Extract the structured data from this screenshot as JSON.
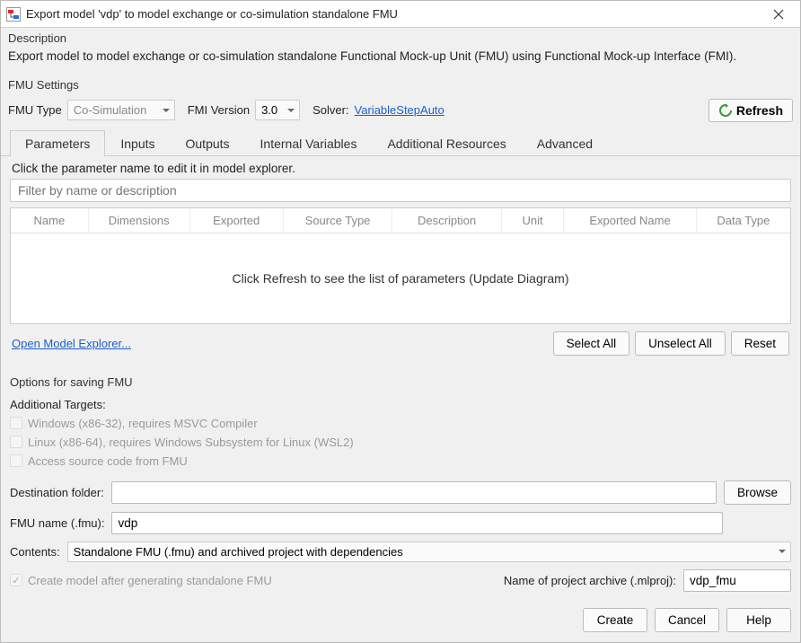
{
  "window": {
    "title": "Export model 'vdp' to model exchange or co-simulation standalone FMU"
  },
  "description": {
    "heading": "Description",
    "text": "Export model to model exchange or co-simulation standalone Functional Mock-up Unit (FMU) using Functional Mock-up Interface (FMI)."
  },
  "fmu_settings": {
    "heading": "FMU Settings",
    "fmu_type_label": "FMU Type",
    "fmu_type_value": "Co-Simulation",
    "fmi_version_label": "FMI Version",
    "fmi_version_value": "3.0",
    "solver_label": "Solver:",
    "solver_value": "VariableStepAuto",
    "refresh_label": "Refresh"
  },
  "tabs": [
    {
      "label": "Parameters",
      "active": true
    },
    {
      "label": "Inputs"
    },
    {
      "label": "Outputs"
    },
    {
      "label": "Internal Variables"
    },
    {
      "label": "Additional Resources"
    },
    {
      "label": "Advanced"
    }
  ],
  "params": {
    "hint": "Click the parameter name to edit it in model explorer.",
    "filter_placeholder": "Filter by name or description",
    "columns": [
      "Name",
      "Dimensions",
      "Exported",
      "Source Type",
      "Description",
      "Unit",
      "Exported Name",
      "Data Type"
    ],
    "empty_text": "Click Refresh to see the list of parameters (Update Diagram)",
    "open_explorer": "Open Model Explorer...",
    "select_all": "Select All",
    "unselect_all": "Unselect All",
    "reset": "Reset"
  },
  "options": {
    "heading": "Options for saving FMU",
    "targets_heading": "Additional Targets:",
    "target_win": "Windows (x86-32), requires MSVC Compiler",
    "target_linux": "Linux (x86-64), requires Windows Subsystem for Linux (WSL2)",
    "target_source": "Access source code from FMU",
    "dest_label": "Destination folder:",
    "dest_value": "",
    "browse": "Browse",
    "fmu_name_label": "FMU name (.fmu):",
    "fmu_name_value": "vdp",
    "contents_label": "Contents:",
    "contents_value": "Standalone FMU (.fmu) and archived project with dependencies",
    "create_model_label": "Create model after generating standalone FMU",
    "archive_label": "Name of project archive (.mlproj):",
    "archive_value": "vdp_fmu"
  },
  "footer": {
    "create": "Create",
    "cancel": "Cancel",
    "help": "Help"
  }
}
